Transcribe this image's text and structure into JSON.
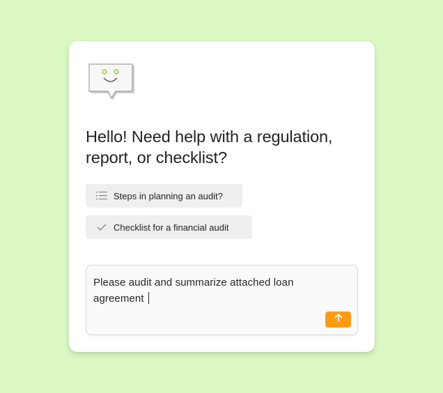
{
  "assistant": {
    "heading": "Hello! Need help with a regulation, report, or checklist?"
  },
  "suggestions": [
    {
      "label": "Steps in planning an audit?",
      "icon": "list-icon"
    },
    {
      "label": "Checklist for a financial audit",
      "icon": "checkmark-icon"
    }
  ],
  "composer": {
    "value": "Please audit and summarize attached loan agreement",
    "send_icon": "arrow-up-icon"
  },
  "colors": {
    "background": "#dcf9c4",
    "card": "#ffffff",
    "accent": "#ff9b12",
    "mascot_eyes": "#9acd32",
    "chip": "#efefef"
  }
}
